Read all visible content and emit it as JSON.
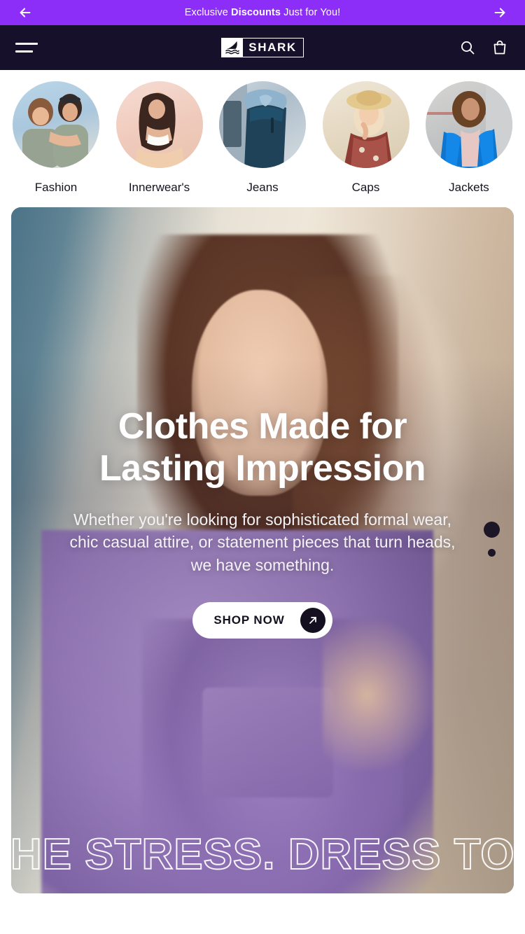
{
  "promo": {
    "text_before": "Exclusive ",
    "text_bold": "Discounts",
    "text_after": " Just for You!",
    "prev_label": "previous-offer",
    "next_label": "next-offer",
    "bg_color": "#8C2EF7"
  },
  "navbar": {
    "menu_label": "menu",
    "brand": "SHARK",
    "brand_icon": "shark-fin-icon",
    "search_label": "search",
    "cart_label": "cart",
    "bg_color": "#16102A"
  },
  "categories": [
    {
      "label": "Fashion",
      "art": "art-fashion"
    },
    {
      "label": "Innerwear's",
      "art": "art-inner"
    },
    {
      "label": "Jeans",
      "art": "art-jeans"
    },
    {
      "label": "Caps",
      "art": "art-caps"
    },
    {
      "label": "Jackets",
      "art": "art-jackets"
    }
  ],
  "hero": {
    "title_line1": "Clothes Made for",
    "title_line2": "Lasting Impression",
    "subtitle": "Whether you're looking for sophisticated formal wear, chic casual attire, or statement pieces that turn heads, we have something.",
    "cta_label": "SHOP NOW",
    "cta_icon": "arrow-up-right-icon",
    "marquee_text": "THE STRESS. DRESS TO",
    "slides": [
      {
        "index": 1,
        "active": true
      },
      {
        "index": 2,
        "active": false
      }
    ]
  }
}
